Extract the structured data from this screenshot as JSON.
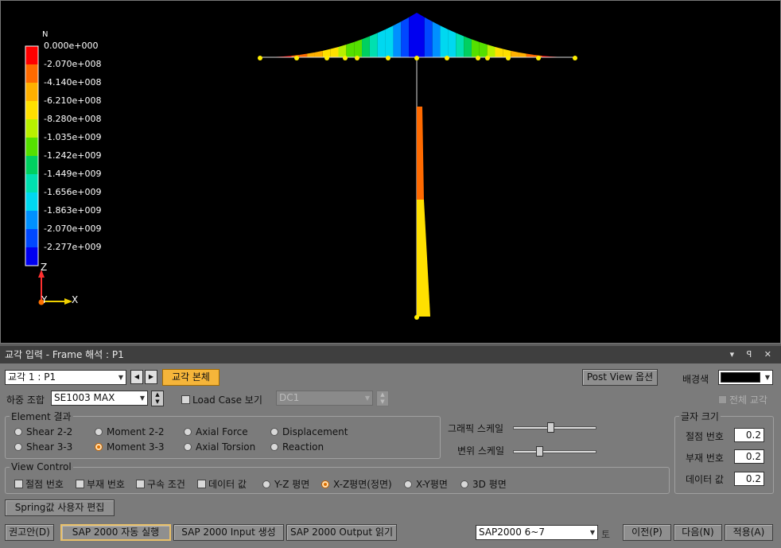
{
  "legend": {
    "title": "N",
    "labels": [
      "0.000e+000",
      "-2.070e+008",
      "-4.140e+008",
      "-6.210e+008",
      "-8.280e+008",
      "-1.035e+009",
      "-1.242e+009",
      "-1.449e+009",
      "-1.656e+009",
      "-1.863e+009",
      "-2.070e+009",
      "-2.277e+009"
    ],
    "colors": [
      "#ff0000",
      "#ff6a00",
      "#ffb000",
      "#ffe000",
      "#b8f000",
      "#55e000",
      "#00d060",
      "#00e0b0",
      "#00d8f0",
      "#0090ff",
      "#0048ff",
      "#0000f0"
    ]
  },
  "axes": {
    "z": "Z",
    "y": "Y",
    "x": "X"
  },
  "panel": {
    "title": "교각 입력 - Frame 해석 : P1",
    "title_buttons": "▾ ꟼ ✕",
    "pier_select": "교각 1 : P1",
    "pier_body_button": "교각 본체",
    "post_view_button": "Post View 옵션",
    "bg_color_label": "배경색",
    "bg_color": "#000000",
    "all_pier_label": "전체 교각",
    "load_combo_label": "하중 조합",
    "load_combo_value": "SE1003 MAX",
    "load_case_label": "Load Case 보기",
    "load_case_value": "DC1",
    "element_result": {
      "label": "Element 결과",
      "options": [
        "Shear 2-2",
        "Moment 2-2",
        "Axial Force",
        "Displacement",
        "Shear 3-3",
        "Moment 3-3",
        "Axial Torsion",
        "Reaction"
      ],
      "selected": "Moment 3-3"
    },
    "graphic_scale_label": "그래픽 스케일",
    "disp_scale_label": "변위 스케일",
    "graphic_scale_level": 0.45,
    "disp_scale_level": 0.3,
    "font_size": {
      "label": "글자 크기",
      "node_label": "절점 번호",
      "node_value": "0.2",
      "member_label": "부재 번호",
      "member_value": "0.2",
      "data_label": "데이터 값",
      "data_value": "0.2"
    },
    "view_control": {
      "label": "View Control",
      "checks": [
        "절점 번호",
        "부재 번호",
        "구속 조건",
        "데이터 값"
      ],
      "planes": [
        "Y-Z 평면",
        "X-Z평면(정면)",
        "X-Y평면",
        "3D 평면"
      ],
      "selected_plane": "X-Z평면(정면)"
    },
    "spring_button": "Spring값 사용자 편집",
    "advice_button": "권고안(D)",
    "sap_run_button": "SAP 2000 자동 실행",
    "sap_input_button": "SAP 2000 Input 생성",
    "sap_output_button": "SAP 2000 Output 읽기",
    "sap_version": "SAP2000 6~7",
    "sap_version_suffix": "토",
    "prev_button": "이전(P)",
    "next_button": "다음(N)",
    "apply_button": "적용(A)"
  }
}
